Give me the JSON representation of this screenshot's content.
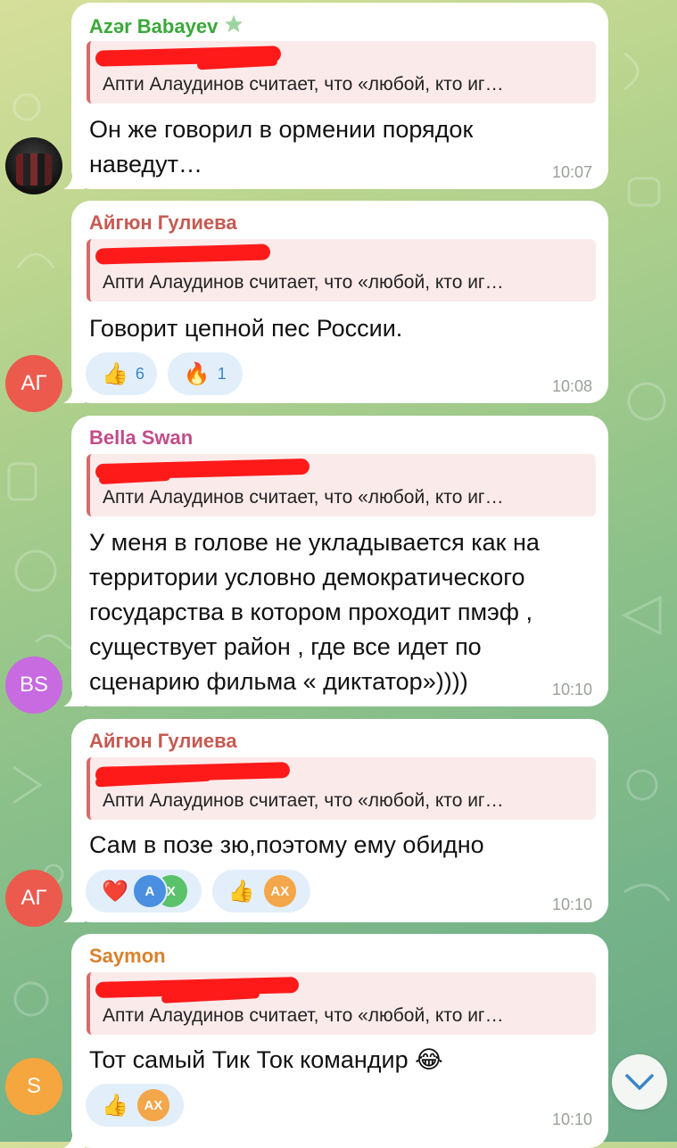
{
  "reply_preview": "Апти Алаудинов считает, что «любой, кто иг…",
  "messages": [
    {
      "sender": "Azər Babayev",
      "sender_color": "#3aa83a",
      "text_lines": [
        "Он же говорил в ормении порядок",
        "наведут…"
      ],
      "time": "10:07",
      "avatar": {
        "type": "photo"
      }
    },
    {
      "sender": "Айгюн Гулиева",
      "sender_color": "#c65a52",
      "text_lines": [
        "Говорит цепной пес России."
      ],
      "time": "10:08",
      "avatar": {
        "type": "initials",
        "label": "АГ",
        "color": "#ec5a4e"
      },
      "reactions": [
        {
          "emoji": "👍",
          "count": "6"
        },
        {
          "emoji": "🔥",
          "count": "1"
        }
      ]
    },
    {
      "sender": "Bella Swan",
      "sender_color": "#c14c8a",
      "text_lines": [
        "У меня в голове не укладывается как на",
        "территории условно демократического",
        "государства в котором проходит пмэф ,",
        "существует район , где все идет по",
        "сценарию фильма « диктатор»))))"
      ],
      "time": "10:10",
      "avatar": {
        "type": "initials",
        "label": "BS",
        "color": "#c86ae0"
      }
    },
    {
      "sender": "Айгюн Гулиева",
      "sender_color": "#c65a52",
      "text_lines": [
        "Сам в позе зю,поэтому ему обидно"
      ],
      "time": "10:10",
      "avatar": {
        "type": "initials",
        "label": "АГ",
        "color": "#ec5a4e"
      },
      "reactions": [
        {
          "emoji": "❤️",
          "users": [
            {
              "label": "А",
              "color": "#4a8fe0"
            },
            {
              "label": "X",
              "color": "#5ac26a"
            }
          ]
        },
        {
          "emoji": "👍",
          "users": [
            {
              "label": "AX",
              "color": "#f4a64a"
            }
          ]
        }
      ]
    },
    {
      "sender": "Saymon",
      "sender_color": "#d9812c",
      "text_lines": [
        "Тот самый Тик Ток командир 😂"
      ],
      "time": "10:10",
      "avatar": {
        "type": "initials",
        "label": "S",
        "color": "#f5a63f"
      },
      "reactions": [
        {
          "emoji": "👍",
          "users": [
            {
              "label": "AX",
              "color": "#f4a64a"
            }
          ]
        }
      ]
    }
  ],
  "scroll_down_icon": "chevron-down-icon"
}
